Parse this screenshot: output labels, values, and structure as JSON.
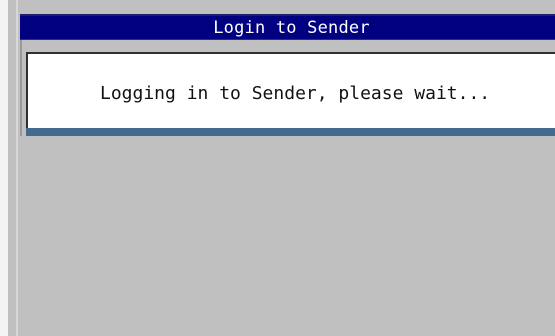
{
  "window": {
    "title": "Login to Sender"
  },
  "message": {
    "text": "Logging in to Sender, please wait..."
  },
  "colors": {
    "titlebar": "#000080",
    "panel": "#ffffff",
    "background": "#c0c0c0",
    "progress": "#436b8f"
  },
  "progress": {
    "value": 1
  }
}
